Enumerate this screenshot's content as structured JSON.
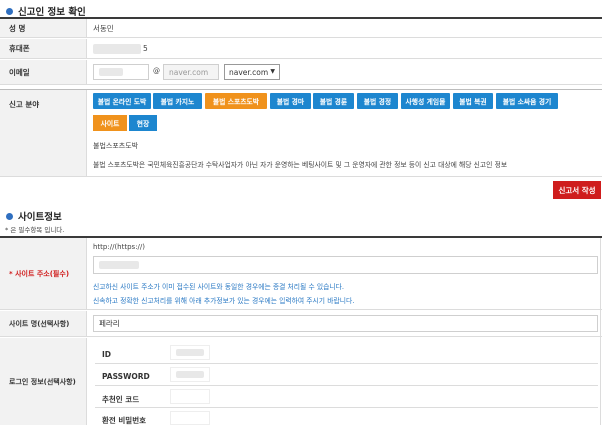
{
  "section1": {
    "title": "신고인 정보 확인",
    "name_label": "성 명",
    "name_value": "서동민",
    "phone_label": "휴대폰",
    "phone_value": "5",
    "email_label": "이메일",
    "email_at": "@",
    "email_domain_value": "naver.com",
    "email_domain_select": "naver.com"
  },
  "report_category": {
    "label": "신고 분야",
    "buttons": [
      "불법 온라인 도박",
      "불법 카지노",
      "불법 스포츠도박",
      "불법 경마",
      "불법 경륜",
      "불법 경정",
      "사행성 게임물",
      "불법 복권",
      "불법 소싸움 경기"
    ],
    "selected_index": 2,
    "sub_buttons": [
      "사이트",
      "현장"
    ],
    "sub_selected_index": 0,
    "desc_title": "불법스포츠도박",
    "desc_text": "불법 스포츠도박은 국민체육진흥공단과 수탁사업자가 아닌 자가 운영하는 베팅사이트 및 그 운영자에 관한 정보 등이 신고 대상에 해당 신고인 정보"
  },
  "submit_button": "신고서 작성",
  "section2": {
    "title": "사이트정보",
    "required_note": "* 은 필수항목 입니다.",
    "site_address_label": "* 사이트 주소(필수)",
    "site_address_hint": "http://(https://)",
    "notice_line1": "신고하신 사이트 주소가 이미 접수된 사이트와 동일한 경우에는 종결 처리될 수 있습니다.",
    "notice_line2": "신속하고 정확한 신고처리를 위해 아래 추가정보가 있는 경우에는 입력하여 주시기 바랍니다.",
    "site_name_label": "사이트 명(선택사항)",
    "site_name_value": "페라리",
    "login_label": "로그인 정보(선택사항)",
    "login_fields": [
      {
        "label": "ID",
        "value": "."
      },
      {
        "label": "PASSWORD",
        "value": "."
      },
      {
        "label": "추천인 코드",
        "value": ""
      },
      {
        "label": "환전 비밀번호",
        "value": ""
      }
    ]
  },
  "colors": {
    "blue_btn": "#1d86cf",
    "orange_btn": "#f0921c",
    "red_btn": "#cf1d1d",
    "notice_blue": "#2a79c4",
    "required_red": "#d01c1c"
  }
}
